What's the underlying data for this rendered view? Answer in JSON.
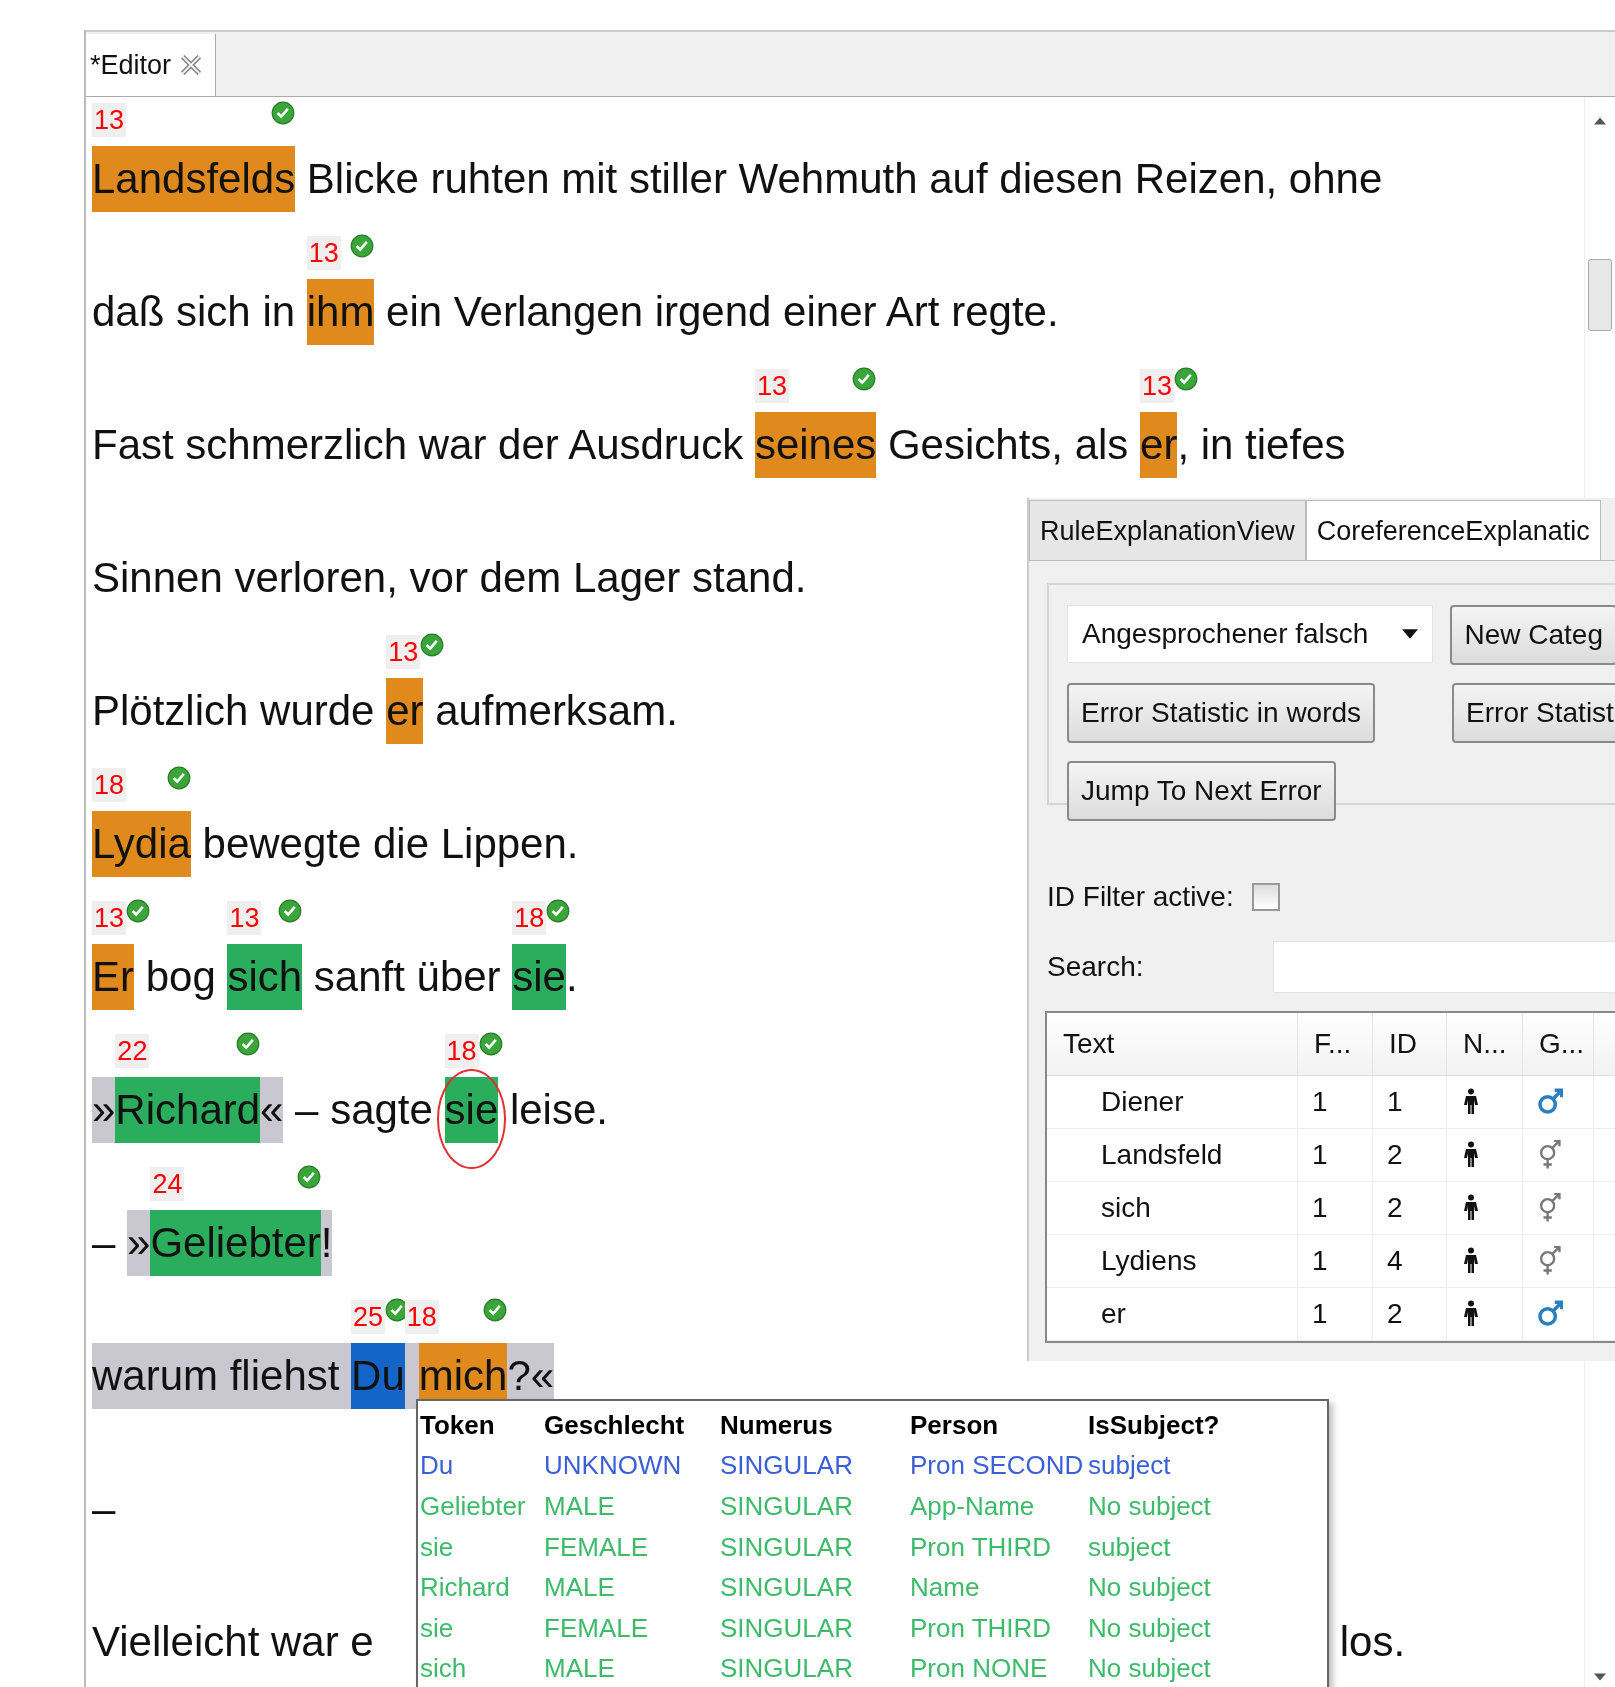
{
  "editor": {
    "tab": {
      "title": "*Editor",
      "selected": true
    },
    "lines": [
      {
        "parts": [
          {
            "kind": "mention",
            "text": "Landsfelds",
            "id": "13",
            "color": "#e08a1e"
          },
          {
            "kind": "text",
            "text": " Blicke ruhten mit stiller Wehmuth auf diesen Reizen, ohne"
          }
        ]
      },
      {
        "parts": [
          {
            "kind": "text",
            "text": "daß sich in "
          },
          {
            "kind": "mention",
            "text": "ihm",
            "id": "13",
            "color": "#e08a1e"
          },
          {
            "kind": "text",
            "text": " ein Verlangen irgend einer Art regte."
          }
        ]
      },
      {
        "parts": [
          {
            "kind": "text",
            "text": "Fast schmerzlich war der Ausdruck "
          },
          {
            "kind": "mention",
            "text": "seines",
            "id": "13",
            "color": "#e08a1e"
          },
          {
            "kind": "text",
            "text": " Gesichts, als "
          },
          {
            "kind": "mention",
            "text": "er",
            "id": "13",
            "color": "#e08a1e"
          },
          {
            "kind": "text",
            "text": ", in tiefes"
          }
        ]
      },
      {
        "parts": [
          {
            "kind": "text",
            "text": "Sinnen verloren, vor dem Lager stand."
          }
        ]
      },
      {
        "parts": [
          {
            "kind": "text",
            "text": "Plötzlich wurde "
          },
          {
            "kind": "mention",
            "text": "er",
            "id": "13",
            "color": "#e08a1e"
          },
          {
            "kind": "text",
            "text": " aufmerksam."
          }
        ]
      },
      {
        "parts": [
          {
            "kind": "mention",
            "text": "Lydia",
            "id": "18",
            "color": "#e08a1e"
          },
          {
            "kind": "text",
            "text": " bewegte die Lippen."
          }
        ]
      },
      {
        "parts": [
          {
            "kind": "mention",
            "text": "Er",
            "id": "13",
            "color": "#e08a1e"
          },
          {
            "kind": "text",
            "text": " bog "
          },
          {
            "kind": "mention",
            "text": "sich",
            "id": "13",
            "color": "#2aad5c"
          },
          {
            "kind": "text",
            "text": " sanft über "
          },
          {
            "kind": "mention",
            "text": "sie",
            "id": "18",
            "color": "#2aad5c"
          },
          {
            "kind": "text",
            "text": "."
          }
        ]
      },
      {
        "parts": [
          {
            "kind": "quote",
            "parts": [
              {
                "kind": "text",
                "text": "»"
              },
              {
                "kind": "mention",
                "text": "Richard",
                "id": "22",
                "color": "#2aad5c"
              },
              {
                "kind": "text",
                "text": "«"
              }
            ]
          },
          {
            "kind": "text",
            "text": " – sagte "
          },
          {
            "kind": "mention",
            "text": "sie",
            "id": "18",
            "color": "#2aad5c",
            "circled": true
          },
          {
            "kind": "text",
            "text": " leise."
          }
        ]
      },
      {
        "parts": [
          {
            "kind": "text",
            "text": "– "
          },
          {
            "kind": "quote",
            "parts": [
              {
                "kind": "text",
                "text": "»"
              },
              {
                "kind": "mention",
                "text": "Geliebter",
                "id": "24",
                "color": "#2aad5c"
              },
              {
                "kind": "text",
                "text": "!"
              }
            ]
          }
        ]
      },
      {
        "parts": [
          {
            "kind": "quote",
            "parts": [
              {
                "kind": "text",
                "text": "warum fliehst "
              },
              {
                "kind": "mention",
                "text": "Du",
                "id": "25",
                "color": "#1565c8"
              },
              {
                "kind": "mention",
                "text": "mich",
                "id": "18",
                "color": "#e08a1e"
              },
              {
                "kind": "text",
                "text": "?«"
              }
            ]
          }
        ]
      },
      {
        "parts": [
          {
            "kind": "text",
            "text": "–"
          }
        ]
      },
      {
        "parts": [
          {
            "kind": "text",
            "text": "Vielleicht war e"
          },
          {
            "kind": "tail",
            "text": "los."
          }
        ]
      }
    ]
  },
  "panel": {
    "tabs": [
      {
        "label": "RuleExplanationView",
        "selected": false
      },
      {
        "label": "CoreferenceExplanatic",
        "selected": true
      }
    ],
    "category": {
      "value": "Angesprochener falsch"
    },
    "buttons": [
      {
        "label": "New Categ"
      },
      {
        "label": "Error Statistic in words"
      },
      {
        "label": "Error Statist"
      },
      {
        "label": "Jump To Next Error"
      }
    ],
    "id_filter": {
      "label": "ID Filter active:",
      "checked": false
    },
    "search": {
      "label": "Search:"
    },
    "table": {
      "columns": [
        "Text",
        "F...",
        "ID",
        "N...",
        "G..."
      ],
      "rows": [
        {
          "text": "Diener",
          "f": "1",
          "id": "1",
          "kind": "male"
        },
        {
          "text": "Landsfeld",
          "f": "1",
          "id": "2",
          "kind": "unknown"
        },
        {
          "text": "sich",
          "f": "1",
          "id": "2",
          "kind": "unknown"
        },
        {
          "text": "Lydiens",
          "f": "1",
          "id": "4",
          "kind": "unknown"
        },
        {
          "text": "er",
          "f": "1",
          "id": "2",
          "kind": "male"
        }
      ]
    }
  },
  "tooltip": {
    "columns": [
      "Token",
      "Geschlecht",
      "Numerus",
      "Person",
      "IsSubject?"
    ],
    "rows": [
      {
        "color": "#3a5fd6",
        "cells": [
          "Du",
          "UNKNOWN",
          "SINGULAR",
          "Pron SECOND",
          "subject"
        ]
      },
      {
        "color": "#3dbb6a",
        "cells": [
          "Geliebter",
          "MALE",
          "SINGULAR",
          "App-Name",
          "No subject"
        ]
      },
      {
        "color": "#3dbb6a",
        "cells": [
          "sie",
          "FEMALE",
          "SINGULAR",
          "Pron THIRD",
          "subject"
        ]
      },
      {
        "color": "#3dbb6a",
        "cells": [
          "Richard",
          "MALE",
          "SINGULAR",
          "Name",
          "No subject"
        ]
      },
      {
        "color": "#3dbb6a",
        "cells": [
          "sie",
          "FEMALE",
          "SINGULAR",
          "Pron THIRD",
          "No subject"
        ]
      },
      {
        "color": "#3dbb6a",
        "cells": [
          "sich",
          "MALE",
          "SINGULAR",
          "Pron NONE",
          "No subject"
        ]
      }
    ]
  }
}
